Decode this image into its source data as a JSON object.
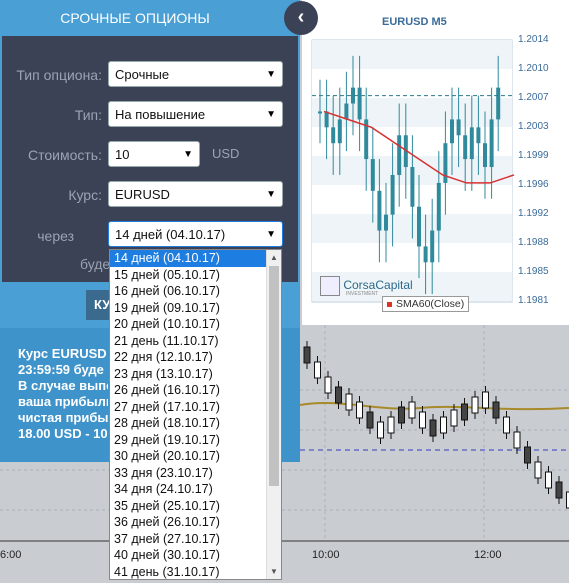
{
  "panel": {
    "title": "СРОЧНЫЕ ОПЦИОНЫ",
    "collapse_icon": "chevron-left-icon",
    "labels": {
      "option_type": "Тип опциона:",
      "type": "Тип:",
      "cost": "Стоимость:",
      "rate": "Курс:",
      "after": "через",
      "partial_bude": "буде"
    },
    "fields": {
      "option_type": "Срочные",
      "type": "На повышение",
      "cost": "10",
      "currency": "USD",
      "rate": "EURUSD",
      "expiry": "14 дней (04.10.17)"
    },
    "buy_button_partial": "КУ",
    "info_lines": [
      "Курс EURUSD",
      "23:59:59 буде",
      "В случае выпо",
      "ваша прибыль",
      "чистая прибыл",
      "18.00 USD - 10"
    ]
  },
  "dropdown": {
    "options": [
      "14 дней (04.10.17)",
      "15 дней (05.10.17)",
      "16 дней (06.10.17)",
      "19 дней (09.10.17)",
      "20 дней (10.10.17)",
      "21 день (11.10.17)",
      "22 дня (12.10.17)",
      "23 дня (13.10.17)",
      "26 дней (16.10.17)",
      "27 дней (17.10.17)",
      "28 дней (18.10.17)",
      "29 дней (19.10.17)",
      "30 дней (20.10.17)",
      "33 дня (23.10.17)",
      "34 дня (24.10.17)",
      "35 дней (25.10.17)",
      "36 дней (26.10.17)",
      "37 дней (27.10.17)",
      "40 дней (30.10.17)",
      "41 день (31.10.17)"
    ],
    "selected_index": 0
  },
  "background_chart": {
    "x_labels": [
      "6:00",
      "10:00",
      "12:00"
    ]
  },
  "mini_chart": {
    "title": "EURUSD M5",
    "y_labels": [
      "1.2014",
      "1.2010",
      "1.2007",
      "1.2003",
      "1.1999",
      "1.1996",
      "1.1992",
      "1.1988",
      "1.1985",
      "1.1981"
    ],
    "legend": "SMA60(Close)",
    "logo_text": "CorsaCapital",
    "logo_sub": "INVESTMENT",
    "colors": {
      "candle": "#2f8a9c",
      "sma": "#d83030",
      "current": "#2a7a86"
    }
  },
  "chart_data": {
    "type": "line",
    "title": "EURUSD M5",
    "series": [
      {
        "name": "SMA60(Close)",
        "values": [
          1.2005,
          1.2004,
          1.2003,
          1.2001,
          1.1999,
          1.1997,
          1.1996,
          1.1996,
          1.1997
        ]
      }
    ],
    "ylim": [
      1.1981,
      1.2014
    ],
    "current_price": 1.2007,
    "grid": true
  }
}
